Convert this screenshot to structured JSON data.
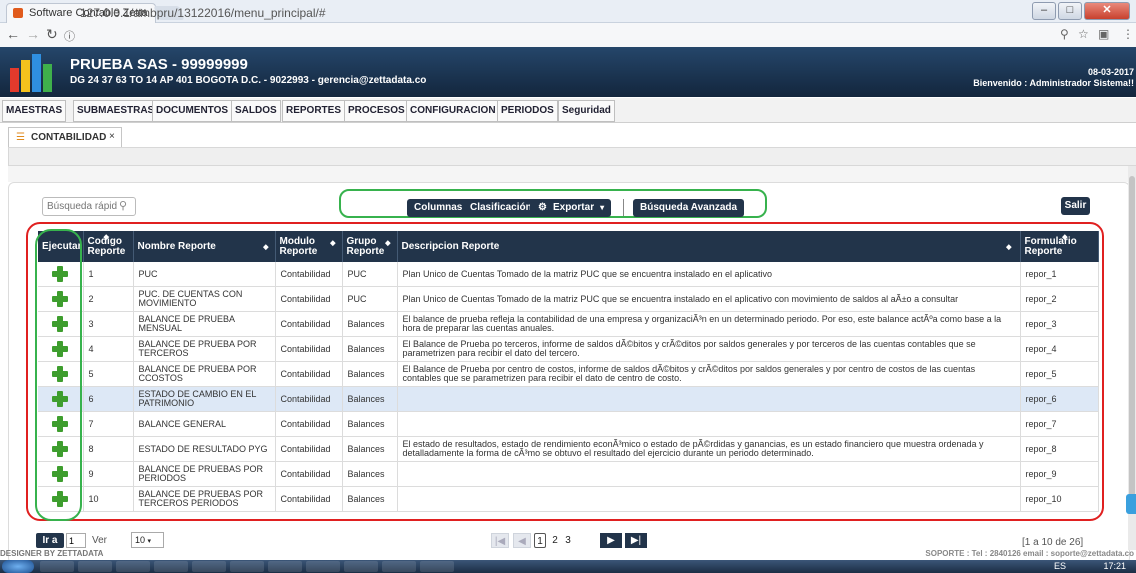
{
  "browser": {
    "tab_title": "Software Contable Zetta",
    "tab_close": "×",
    "url": "127.0.0.1/ambpru/13122016/menu_principal/#",
    "window_buttons": [
      "–",
      "□",
      "✕"
    ]
  },
  "header": {
    "company": "PRUEBA SAS - 99999999",
    "address": "DG 24 37 63 TO 14 AP 401 BOGOTA D.C. - 9022993 - gerencia@zettadata.co",
    "date": "08-03-2017",
    "welcome": "Bienvenido : Administrador Sistema!!"
  },
  "menu": [
    "MAESTRAS",
    "SUBMAESTRAS",
    "DOCUMENTOS",
    "SALDOS",
    "REPORTES",
    "PROCESOS",
    "CONFIGURACION",
    "PERIODOS",
    "Seguridad"
  ],
  "worktab": {
    "label": "CONTABILIDAD",
    "close": "×"
  },
  "toolbar": {
    "search_placeholder": "Búsqueda rápid",
    "columnas": "Columnas",
    "clasificacion": "Clasificación",
    "exportar": "Exportar",
    "busqueda_avanzada": "Búsqueda Avanzada",
    "salir": "Salir"
  },
  "table": {
    "headers": [
      "Ejecutar",
      "Codigo Reporte",
      "Nombre Reporte",
      "Modulo Reporte",
      "Grupo Reporte",
      "Descripcion Reporte",
      "Formulario Reporte"
    ],
    "rows": [
      {
        "codigo": "1",
        "nombre": "PUC",
        "modulo": "Contabilidad",
        "grupo": "PUC",
        "descripcion": "Plan Unico de Cuentas Tomado de la matriz PUC que se encuentra instalado en el aplicativo",
        "formulario": "repor_1"
      },
      {
        "codigo": "2",
        "nombre": "PUC. DE CUENTAS CON MOVIMIENTO",
        "modulo": "Contabilidad",
        "grupo": "PUC",
        "descripcion": "Plan Unico de Cuentas Tomado de la matriz PUC que se encuentra instalado en el aplicativo con movimiento de saldos al aÃ±o a consultar",
        "formulario": "repor_2"
      },
      {
        "codigo": "3",
        "nombre": "BALANCE DE PRUEBA MENSUAL",
        "modulo": "Contabilidad",
        "grupo": "Balances",
        "descripcion": "El balance de prueba refleja la contabilidad de una empresa y organizaciÃ³n en un determinado periodo. Por eso, este balance actÃºa como base a la hora de preparar las cuentas anuales.",
        "formulario": "repor_3"
      },
      {
        "codigo": "4",
        "nombre": "BALANCE DE PRUEBA POR TERCEROS",
        "modulo": "Contabilidad",
        "grupo": "Balances",
        "descripcion": "El Balance de Prueba po terceros, informe de saldos dÃ©bitos y crÃ©ditos por saldos generales y por terceros de las cuentas contables que se parametrizen para recibir el dato del tercero.",
        "formulario": "repor_4"
      },
      {
        "codigo": "5",
        "nombre": "BALANCE DE PRUEBA POR CCOSTOS",
        "modulo": "Contabilidad",
        "grupo": "Balances",
        "descripcion": "El Balance de Prueba por centro de costos, informe de saldos dÃ©bitos y crÃ©ditos por saldos generales y por centro de costos de las cuentas contables que se parametrizen para recibir el dato de centro de costo.",
        "formulario": "repor_5"
      },
      {
        "codigo": "6",
        "nombre": "ESTADO DE CAMBIO EN EL PATRIMONIO",
        "modulo": "Contabilidad",
        "grupo": "Balances",
        "descripcion": "",
        "formulario": "repor_6"
      },
      {
        "codigo": "7",
        "nombre": "BALANCE GENERAL",
        "modulo": "Contabilidad",
        "grupo": "Balances",
        "descripcion": "",
        "formulario": "repor_7"
      },
      {
        "codigo": "8",
        "nombre": "ESTADO DE RESULTADO PYG",
        "modulo": "Contabilidad",
        "grupo": "Balances",
        "descripcion": "El estado de resultados, estado de rendimiento econÃ³mico o estado de pÃ©rdidas y ganancias, es un estado financiero que muestra ordenada y detalladamente la forma de cÃ³mo se obtuvo el resultado del ejercicio durante un periodo determinado.",
        "formulario": "repor_8"
      },
      {
        "codigo": "9",
        "nombre": "BALANCE DE PRUEBAS POR PERIODOS",
        "modulo": "Contabilidad",
        "grupo": "Balances",
        "descripcion": "",
        "formulario": "repor_9"
      },
      {
        "codigo": "10",
        "nombre": "BALANCE DE PRUEBAS POR TERCEROS PERIODOS",
        "modulo": "Contabilidad",
        "grupo": "Balances",
        "descripcion": "",
        "formulario": "repor_10"
      }
    ]
  },
  "pager": {
    "ir_a": "Ir a",
    "goto_value": "1",
    "ver": "Ver",
    "page_size": "10",
    "pages": [
      "1",
      "2",
      "3"
    ],
    "info": "[1 a 10 de 26]"
  },
  "footer": {
    "left": "DESIGNER BY ZETTADATA",
    "right": "SOPORTE : Tel : 2840126 email : soporte@zettadata.co"
  },
  "taskbar": {
    "lang": "ES",
    "time": "17:21"
  }
}
